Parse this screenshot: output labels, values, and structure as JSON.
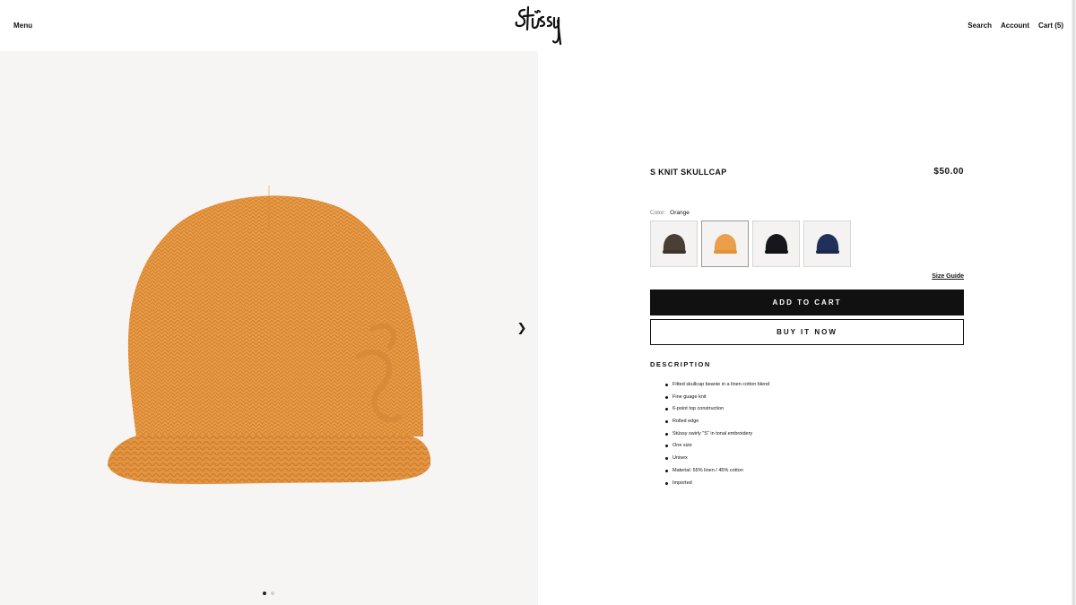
{
  "header": {
    "menu_label": "Menu",
    "search_label": "Search",
    "account_label": "Account",
    "cart_label": "Cart (5)"
  },
  "gallery": {
    "slide_count": 2,
    "active_slide": 1
  },
  "product": {
    "title": "S KNIT SKULLCAP",
    "price": "$50.00",
    "color_label": "Color:",
    "color_value": "Orange",
    "swatches": [
      {
        "name": "Brown",
        "color": "#4a3f36"
      },
      {
        "name": "Orange",
        "color": "#eaa04a"
      },
      {
        "name": "Black",
        "color": "#15171b"
      },
      {
        "name": "Navy",
        "color": "#20305a"
      }
    ],
    "size_guide_label": "Size Guide",
    "add_to_cart_label": "ADD TO CART",
    "buy_now_label": "BUY IT NOW",
    "description_title": "DESCRIPTION",
    "description_items": [
      "Fitted skullcap beanie in a linen cotton blend",
      "Fine guage knit",
      "6-point top construction",
      "Rolled edge",
      "Stüssy swirly \"S\" in tonal embroidery",
      "One size",
      "Unisex",
      "Material: 55% linen / 45% cotton",
      "Imported"
    ]
  },
  "colors": {
    "accent": "#111111",
    "product_orange": "#e89a45"
  }
}
